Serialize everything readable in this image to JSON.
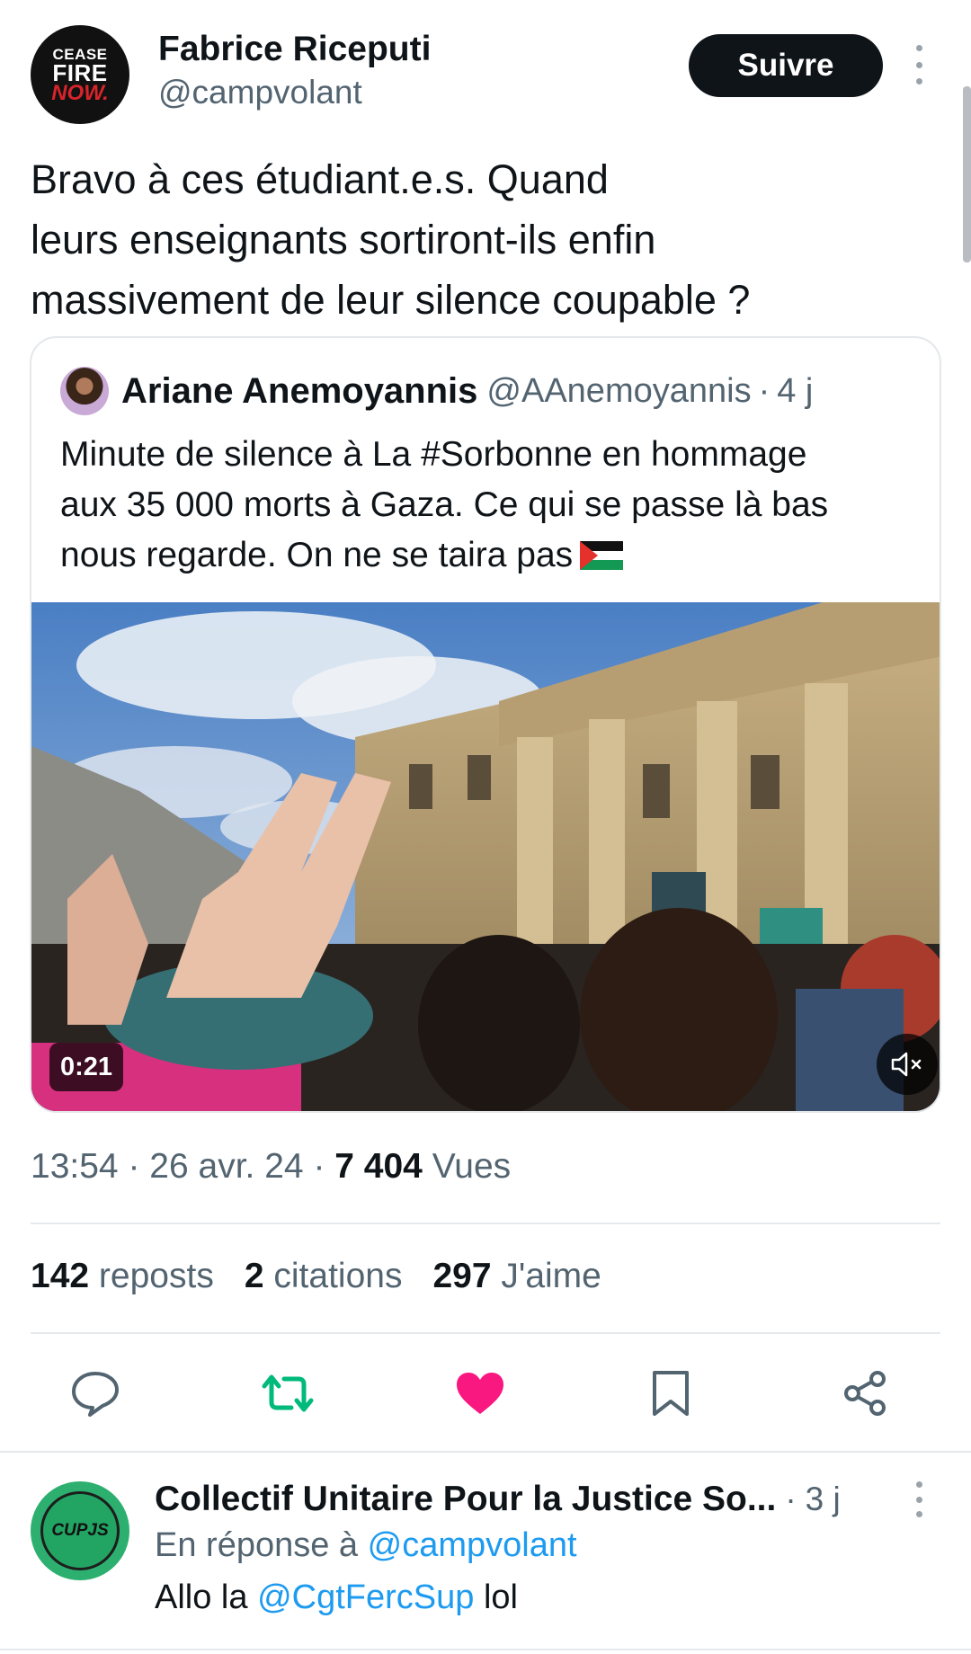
{
  "post": {
    "author": {
      "display_name": "Fabrice Riceputi",
      "handle": "@campvolant",
      "avatar_logo_text": [
        "CEASE",
        "FIRE",
        "NOW."
      ]
    },
    "follow_label": "Suivre",
    "text_lines": [
      "Bravo à ces étudiant.e.s. Quand",
      "leurs enseignants sortiront-ils enfin",
      "massivement de leur silence coupable ?"
    ]
  },
  "quote": {
    "display_name": "Ariane Anemoyannis",
    "handle": "@AAnemoyannis",
    "separator": "·",
    "time": "4 j",
    "text_lines": [
      "Minute de silence à La #Sorbonne en hommage",
      "aux 35 000 morts à Gaza. Ce qui se passe là bas",
      "nous regarde. On ne se taira pas"
    ],
    "flag_icon": "palestine-flag-emoji",
    "video": {
      "duration": "0:21",
      "mute_icon": "speaker-muted-icon"
    }
  },
  "meta": {
    "time": "13:54",
    "sep1": "·",
    "date": "26 avr. 24",
    "sep2": "·",
    "views_count": "7 404",
    "views_label": "Vues"
  },
  "stats": {
    "reposts_count": "142",
    "reposts_label": "reposts",
    "quotes_count": "2",
    "quotes_label": "citations",
    "likes_count": "297",
    "likes_label": "J'aime"
  },
  "actions": {
    "reply_icon": "reply-icon",
    "repost_icon": "repost-icon",
    "like_icon": "like-icon",
    "bookmark_icon": "bookmark-icon",
    "share_icon": "share-icon",
    "repost_color": "#00ba7c",
    "like_color": "#f91880"
  },
  "reply": {
    "display_name": "Collectif Unitaire Pour la Justice So...",
    "sep": "·",
    "time": "3 j",
    "avatar_text": "CUPJS",
    "reply_to_prefix": "En réponse à",
    "reply_to_handle": "@campvolant",
    "text_prefix": "Allo la",
    "mention": "@CgtFercSup",
    "text_suffix": "lol"
  },
  "colors": {
    "text": "#0f1419",
    "secondary": "#536471",
    "link": "#1d9bf0",
    "follow_bg": "#0f1419"
  }
}
